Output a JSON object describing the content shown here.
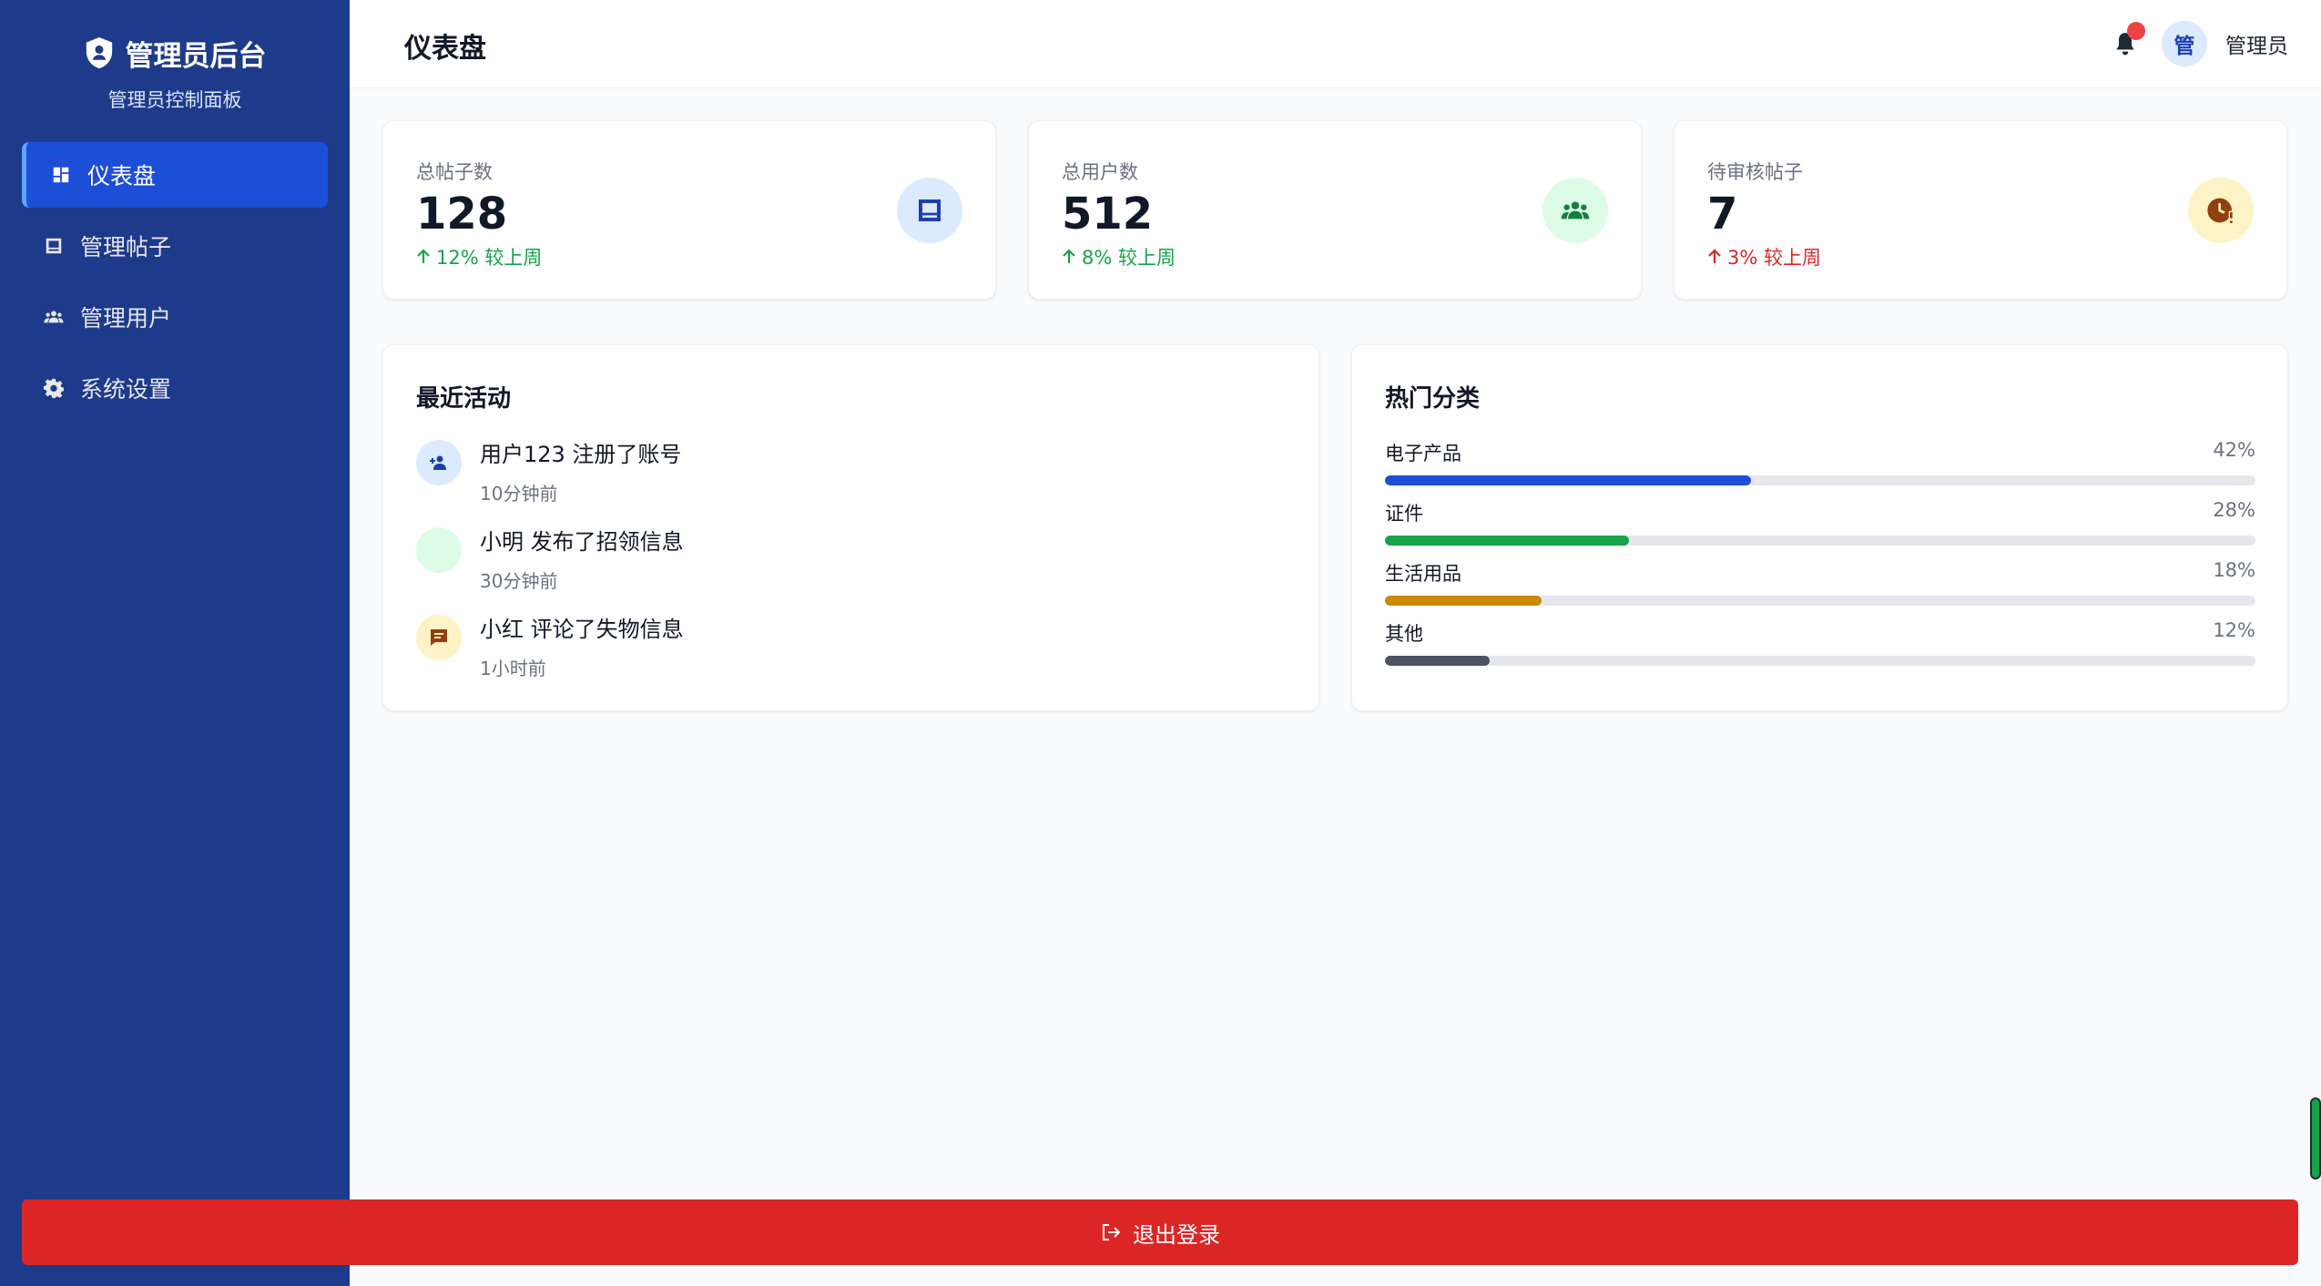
{
  "brand": {
    "title": "管理员后台",
    "subtitle": "管理员控制面板"
  },
  "nav": [
    {
      "label": "仪表盘",
      "icon": "dashboard-icon",
      "active": true
    },
    {
      "label": "管理帖子",
      "icon": "posts-icon",
      "active": false
    },
    {
      "label": "管理用户",
      "icon": "users-icon",
      "active": false
    },
    {
      "label": "系统设置",
      "icon": "gear-icon",
      "active": false
    }
  ],
  "header": {
    "title": "仪表盘",
    "avatar_text": "管",
    "user_name": "管理员",
    "has_notification": true
  },
  "stats": [
    {
      "label": "总帖子数",
      "value": "128",
      "change": "12% 较上周",
      "trend": "up",
      "icon": "posts-icon",
      "icon_bg": "#dbeafe",
      "icon_color": "#1e40af"
    },
    {
      "label": "总用户数",
      "value": "512",
      "change": "8% 较上周",
      "trend": "up",
      "icon": "users-icon",
      "icon_bg": "#dcfce7",
      "icon_color": "#15803d"
    },
    {
      "label": "待审核帖子",
      "value": "7",
      "change": "3% 较上周",
      "trend": "down",
      "icon": "pending-clock-icon",
      "icon_bg": "#fef3c7",
      "icon_color": "#92400e"
    }
  ],
  "recent_activity": {
    "title": "最近活动",
    "items": [
      {
        "text": "用户123 注册了账号",
        "time": "10分钟前",
        "icon": "add-user-icon",
        "icon_bg": "#dbeafe"
      },
      {
        "text": "小明 发布了招领信息",
        "time": "30分钟前",
        "icon": "",
        "icon_bg": "#dcfce7"
      },
      {
        "text": "小红 评论了失物信息",
        "time": "1小时前",
        "icon": "comment-icon",
        "icon_bg": "#fef3c7"
      }
    ]
  },
  "hot_categories": {
    "title": "热门分类",
    "items": [
      {
        "name": "电子产品",
        "percent_label": "42%",
        "percent": 42,
        "color": "#1d4ed8"
      },
      {
        "name": "证件",
        "percent_label": "28%",
        "percent": 28,
        "color": "#16a34a"
      },
      {
        "name": "生活用品",
        "percent_label": "18%",
        "percent": 18,
        "color": "#ca8a04"
      },
      {
        "name": "其他",
        "percent_label": "12%",
        "percent": 12,
        "color": "#4b5563"
      }
    ]
  },
  "logout": {
    "label": "退出登录"
  },
  "colors": {
    "sidebar": "#1e3a8a",
    "active_nav": "#1d4ed8",
    "logout": "#dc2626"
  }
}
